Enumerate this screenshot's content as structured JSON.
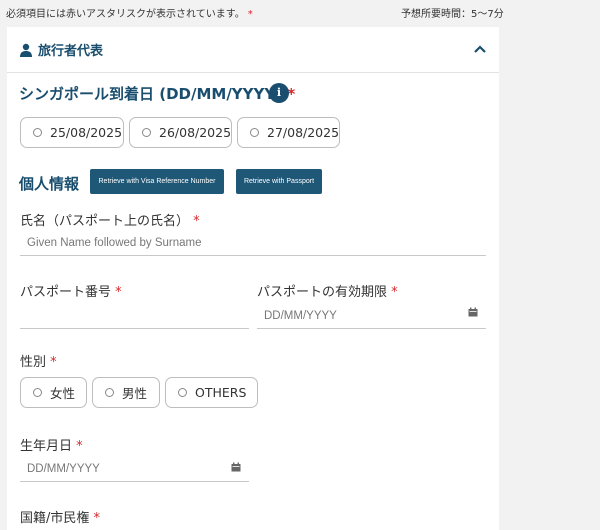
{
  "notice": {
    "text": "必須項目には赤いアスタリスクが表示されています。",
    "asterisk": "*"
  },
  "time_estimate": "予想所要時間：5～7分",
  "section": {
    "title": "旅行者代表",
    "icon": "user-icon",
    "collapse_icon": "chevron-up-icon"
  },
  "arrival": {
    "label": "シンガポール到着日 (DD/MM/YYYY)",
    "asterisk": "*",
    "info_glyph": "i",
    "options": [
      "25/08/2025",
      "26/08/2025",
      "27/08/2025"
    ]
  },
  "personal": {
    "title": "個人情報",
    "visa_button": "Retrieve with Visa Reference Number",
    "passport_button": "Retrieve with Passport"
  },
  "fields": {
    "name_label": "氏名（パスポート上の氏名）",
    "name_placeholder": "Given Name followed by Surname",
    "passport_no_label": "パスポート番号",
    "passport_expiry_label": "パスポートの有効期限",
    "passport_expiry_placeholder": "DD/MM/YYYY",
    "sex_label": "性別",
    "sex_options": [
      "女性",
      "男性",
      "OTHERS"
    ],
    "dob_label": "生年月日",
    "dob_placeholder": "DD/MM/YYYY",
    "nationality_label": "国籍/市民権",
    "asterisk": "*"
  },
  "colors": {
    "accent": "#1a4e6e",
    "required": "#d9262b",
    "button": "#1f5777"
  }
}
